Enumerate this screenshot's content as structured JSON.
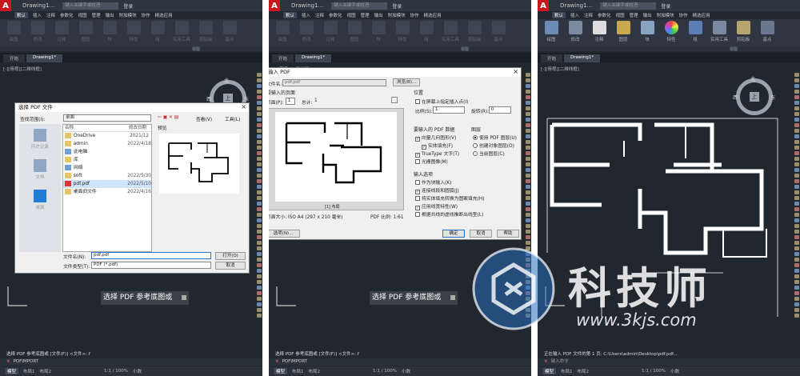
{
  "titlebar": {
    "doc": "Drawing1...",
    "search_placeholder": "键入关键字或短语",
    "login": "登录"
  },
  "menu": [
    "默认",
    "插入",
    "注释",
    "参数化",
    "视图",
    "管理",
    "输出",
    "附加模块",
    "协作",
    "精选应用"
  ],
  "ribbon_p3": [
    "绘图",
    "修改",
    "注释",
    "图层",
    "块",
    "特性",
    "组",
    "实用工具",
    "剪贴板",
    "基点"
  ],
  "ribbon_tail": "视图",
  "tabs": {
    "start": "开始",
    "drawing": "Drawing1*"
  },
  "viewport_label": "[-][俯视][二维线框]",
  "compass": {
    "n": "北",
    "e": "东",
    "w": "西",
    "top": "上",
    "s": "南"
  },
  "panel1": {
    "dialog_title": "选择 PDF 文件",
    "lookin_label": "查找范围(I):",
    "lookin_value": "桌面",
    "toolbar": {
      "views": "查看(V)",
      "tools": "工具(L)"
    },
    "places": [
      "历史记录",
      "文档",
      "桌面"
    ],
    "col_name": "名称",
    "col_date": "修改日期",
    "preview_label": "预览",
    "files": [
      {
        "name": "OneDrive",
        "date": "2021/12"
      },
      {
        "name": "admin",
        "date": "2022/4/18"
      },
      {
        "name": "此电脑",
        "date": ""
      },
      {
        "name": "库",
        "date": ""
      },
      {
        "name": "网络",
        "date": ""
      },
      {
        "name": "soft",
        "date": "2022/5/30"
      },
      {
        "name": "pdf.pdf",
        "date": "2022/5/10"
      },
      {
        "name": "桌面旧文件",
        "date": "2022/4/16"
      }
    ],
    "filename_label": "文件名(N):",
    "filename_value": "pdf.pdf",
    "filetype_label": "文件类型(T):",
    "filetype_value": "PDF (*.pdf)",
    "open_btn": "打开(O)",
    "cancel_btn": "取消"
  },
  "panel2": {
    "dialog_title": "输入 PDF",
    "file_label": "文件名:",
    "file_value": "pdf.pdf",
    "browse_btn": "浏览(B)...",
    "pages_label": "要输入的页面",
    "page_label": "页面(P):",
    "page_value": "1",
    "total_label": "总计:",
    "total_value": "1",
    "position_label": "位置",
    "onscreen_label": "在屏幕上指定插入点(I)",
    "scale_label": "比例(S):",
    "scale_value": "1",
    "rotation_label": "旋转(R):",
    "rotation_value": "0",
    "data_label": "要输入的 PDF 数据",
    "data_opts": [
      {
        "t": "向量几何图形(V)",
        "c": true
      },
      {
        "t": "实体填充(F)",
        "c": true
      },
      {
        "t": "TrueType 文字(T)",
        "c": true
      },
      {
        "t": "光栅图像(M)",
        "c": false
      }
    ],
    "layer_label": "图层",
    "layer_opts": [
      {
        "t": "使用 PDF 图层(U)",
        "c": true
      },
      {
        "t": "创建对象图层(O)",
        "c": false
      },
      {
        "t": "当前图层(C)",
        "c": false
      }
    ],
    "import_label": "输入选项",
    "import_opts": [
      {
        "t": "作为块输入(K)",
        "c": false
      },
      {
        "t": "连接线段和圆弧(J)",
        "c": true
      },
      {
        "t": "将实体填充转换为图案填充(H)",
        "c": false
      },
      {
        "t": "应用线宽特性(W)",
        "c": true
      },
      {
        "t": "根据共线的虚线推断出线型(L)",
        "c": false
      }
    ],
    "preview_caption": "[1] 布局",
    "page_size": "页面大小: ISO A4 (297 x 210 毫米)",
    "pdf_scale": "PDF 比例: 1:61",
    "options_btn": "选项(N)...",
    "ok_btn": "确定",
    "cancel_btn": "取消",
    "help_btn": "帮助"
  },
  "caption": "选择 PDF 参考底图或",
  "cmd": {
    "p1_line1": "选择 PDF 参考底图或 [文件(F)] <文件>: f",
    "p1_line2": "PDFIMPORT",
    "p2_line1": "选择 PDF 参考底图或 [文件(F)] <文件>: f",
    "p2_line2": "PDFIMPORT",
    "p3_line1": "正在输入 PDF 文件的第 1 页: C:\\Users\\admin\\Desktop\\pdf.pdf...",
    "p3_line2": "键入命令"
  },
  "status": {
    "model": "模型",
    "layout1": "布局1",
    "layout2": "布局2",
    "scale": "1:1 / 100%",
    "units": "小数"
  },
  "watermark": {
    "brand": "科技师",
    "url": "www.3kjs.com"
  }
}
